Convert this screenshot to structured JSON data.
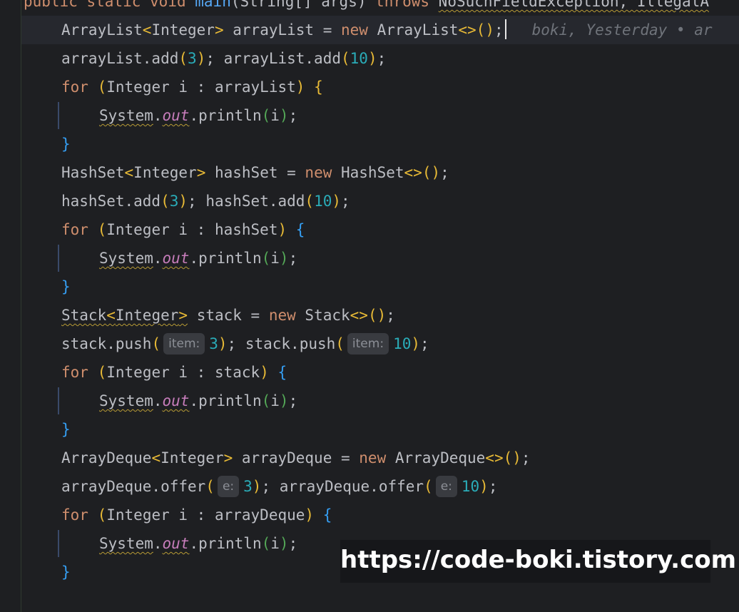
{
  "header_line": {
    "public_kw": "public",
    "static_kw": "static",
    "void_kw": "void",
    "method": "main",
    "params": "(String[] args)",
    "throws_kw": "throws",
    "exceptions": "NoSuchFieldException, IllegalA"
  },
  "lines": {
    "l1_type": "ArrayList",
    "l1_generic": "Integer",
    "l1_var": " arrayList = ",
    "l1_new": "new",
    "l1_ctor": " ArrayList",
    "l1_diamond": "<>",
    "l1_semicolon": ";",
    "l2_a": "arrayList.add",
    "l2_n1": "3",
    "l2_b": "; arrayList.add",
    "l2_n2": "10",
    "for_kw": "for",
    "l3_loop": "Integer i : arrayList",
    "sysout_system": "System",
    "sysout_out": "out",
    "sysout_rest": ".println",
    "sysout_arg": "i",
    "close_brace": "}",
    "open_brace": "{",
    "l6_type": "HashSet",
    "l6_generic": "Integer",
    "l6_var": " hashSet = ",
    "l6_new": "new",
    "l6_ctor": " HashSet",
    "l7_a": "hashSet.add",
    "l7_n1": "3",
    "l7_b": "; hashSet.add",
    "l7_n2": "10",
    "l8_loop": "Integer i : hashSet",
    "l11_type": "Stack",
    "l11_generic": "Integer",
    "l11_var": " stack = ",
    "l11_new": "new",
    "l11_ctor": " Stack",
    "l12_a": "stack.push",
    "l12_hint1": "item:",
    "l12_n1": "3",
    "l12_b": "; stack.push",
    "l12_hint2": "item:",
    "l12_n2": "10",
    "l13_loop": "Integer i : stack",
    "l16_type": "ArrayDeque",
    "l16_generic": "Integer",
    "l16_var": " arrayDeque = ",
    "l16_new": "new",
    "l16_ctor": " ArrayDeque",
    "l17_a": "arrayDeque.offer",
    "l17_hint1": "e:",
    "l17_n1": "3",
    "l17_b": "; arrayDeque.offer",
    "l17_hint2": "e:",
    "l17_n2": "10",
    "l18_loop": "Integer i : arrayDeque"
  },
  "blame_annotation": "boki, Yesterday • ar",
  "watermark": "https://code-boki.tistory.com",
  "colors": {
    "background": "#1e1f22",
    "keyword": "#cf8e6d",
    "number": "#2aacb8",
    "static_field": "#c77dbb",
    "paren_level1": "#e8ba36",
    "paren_level2": "#54a857",
    "paren_level3": "#359ff4"
  }
}
